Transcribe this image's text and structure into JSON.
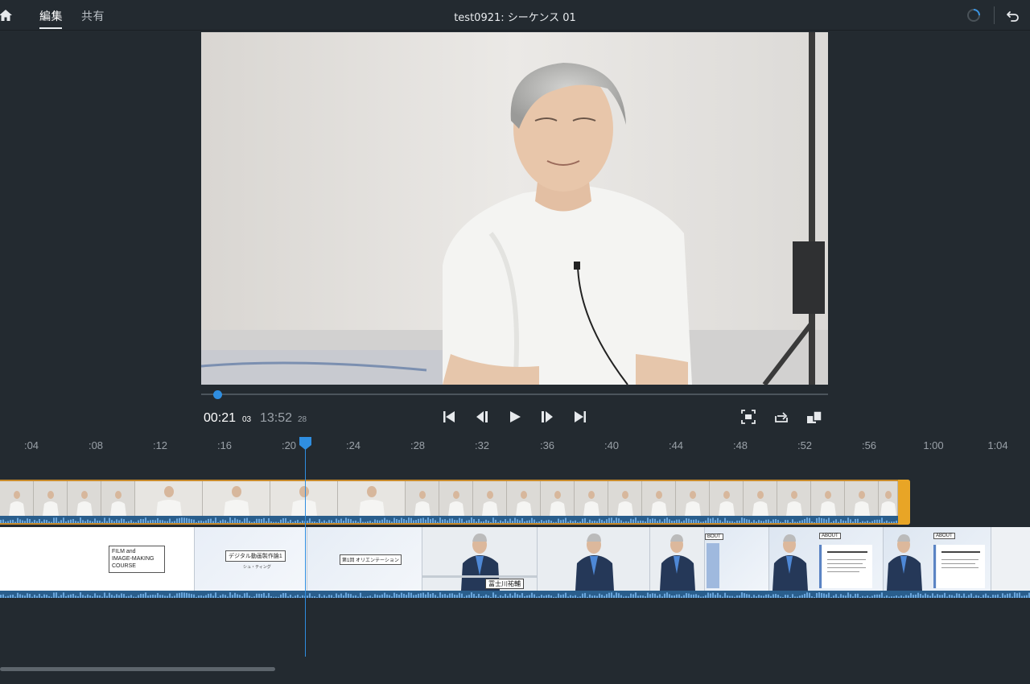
{
  "header": {
    "tabs": [
      {
        "label": "編集",
        "active": true
      },
      {
        "label": "共有",
        "active": false
      }
    ],
    "title": "test0921: シーケンス 01"
  },
  "player": {
    "progress": 0.026,
    "current_time": "00:21",
    "current_frames": "03",
    "total_time": "13:52",
    "total_frames": "28"
  },
  "timeline": {
    "ticks": [
      ":04",
      ":08",
      ":12",
      ":16",
      ":20",
      ":24",
      ":28",
      ":32",
      ":36",
      ":40",
      ":44",
      ":48",
      ":52",
      ":56",
      "1:00",
      "1:04"
    ],
    "title_clips": {
      "film_line1": "FILM and",
      "film_line2": "IMAGE-MAKING",
      "film_line3": "COURSE",
      "digital_title": "デジタル動画製作論1",
      "digital_sub": "シュ・ティング",
      "orientation": "第1回 オリエンテーション",
      "name_plate": "冨士川祐輔",
      "about": "ABOUT",
      "about_partial": "BOUT"
    }
  },
  "colors": {
    "accent": "#2f8ee0",
    "clip_handle": "#e8a526",
    "background": "#232a30"
  }
}
